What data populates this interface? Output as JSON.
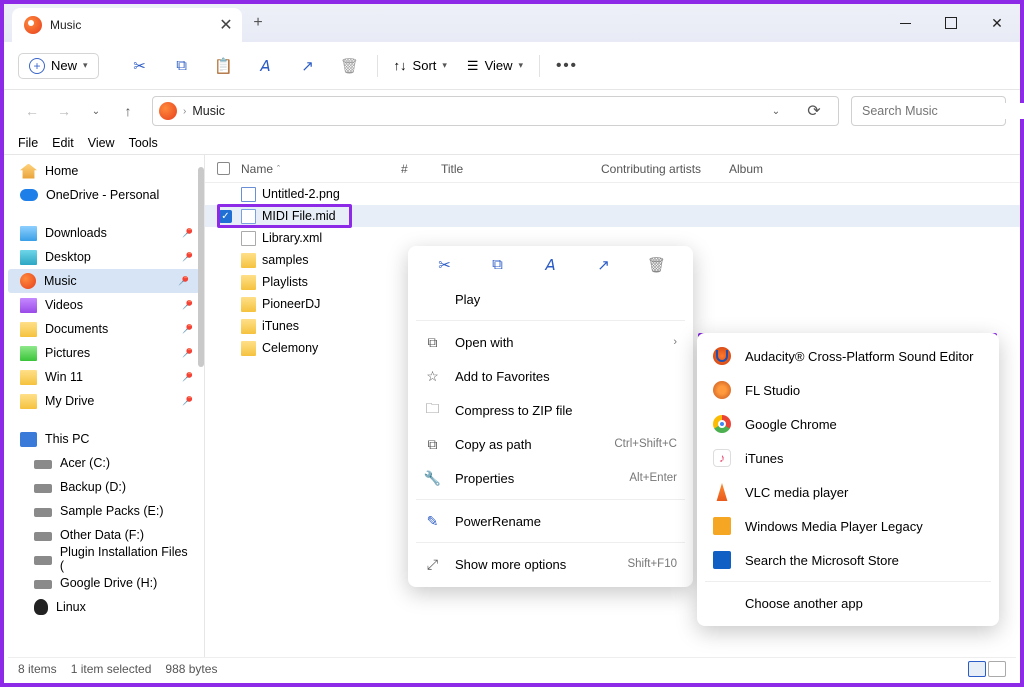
{
  "titlebar": {
    "tab_title": "Music"
  },
  "toolbar": {
    "new_label": "New",
    "sort_label": "Sort",
    "view_label": "View"
  },
  "path": {
    "location": "Music"
  },
  "search": {
    "placeholder": "Search Music"
  },
  "menubar": {
    "file": "File",
    "edit": "Edit",
    "view": "View",
    "tools": "Tools"
  },
  "sidebar": {
    "home": "Home",
    "onedrive": "OneDrive - Personal",
    "downloads": "Downloads",
    "desktop": "Desktop",
    "music": "Music",
    "videos": "Videos",
    "documents": "Documents",
    "pictures": "Pictures",
    "win11": "Win 11",
    "mydrive": "My Drive",
    "thispc": "This PC",
    "acer": "Acer (C:)",
    "backup": "Backup (D:)",
    "samplepacks": "Sample Packs (E:)",
    "otherdata": "Other Data (F:)",
    "plugin": "Plugin Installation Files (",
    "gdrive": "Google Drive (H:)",
    "linux": "Linux"
  },
  "columns": {
    "name": "Name",
    "num": "#",
    "title": "Title",
    "artist": "Contributing artists",
    "album": "Album"
  },
  "files": {
    "f0": "Untitled-2.png",
    "f1": "MIDI File.mid",
    "f2": "Library.xml",
    "f3": "samples",
    "f4": "Playlists",
    "f5": "PioneerDJ",
    "f6": "iTunes",
    "f7": "Celemony"
  },
  "context1": {
    "play": "Play",
    "openwith": "Open with",
    "favorites": "Add to Favorites",
    "compress": "Compress to ZIP file",
    "copypath": "Copy as path",
    "copypath_sc": "Ctrl+Shift+C",
    "properties": "Properties",
    "properties_sc": "Alt+Enter",
    "powerrename": "PowerRename",
    "showmore": "Show more options",
    "showmore_sc": "Shift+F10"
  },
  "context2": {
    "audacity": "Audacity® Cross-Platform Sound Editor",
    "flstudio": "FL Studio",
    "chrome": "Google Chrome",
    "itunes": "iTunes",
    "vlc": "VLC media player",
    "wmp": "Windows Media Player Legacy",
    "store": "Search the Microsoft Store",
    "another": "Choose another app"
  },
  "status": {
    "items": "8 items",
    "selected": "1 item selected",
    "size": "988 bytes"
  }
}
